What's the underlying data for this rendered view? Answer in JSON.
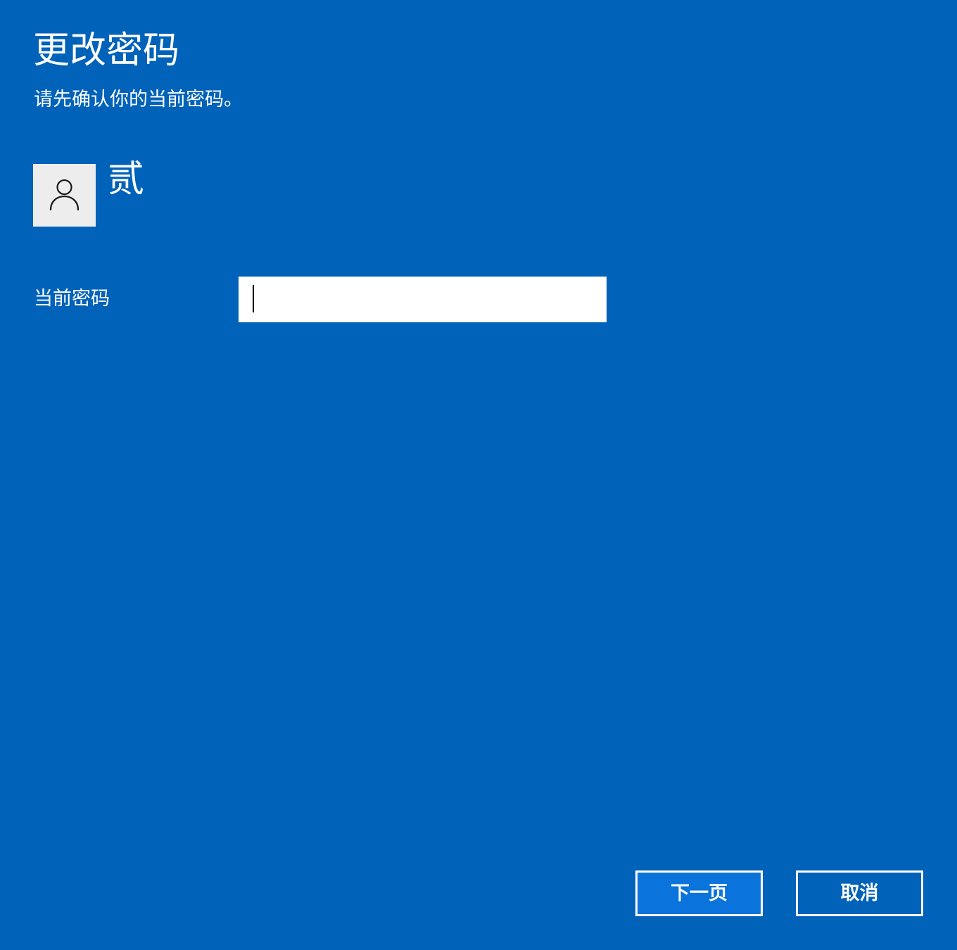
{
  "dialog": {
    "title": "更改密码",
    "subtitle": "请先确认你的当前密码。"
  },
  "account": {
    "username": "贰",
    "avatar_icon": "user-icon"
  },
  "form": {
    "current_password_label": "当前密码",
    "current_password_value": "",
    "current_password_placeholder": ""
  },
  "buttons": {
    "next_label": "下一页",
    "cancel_label": "取消"
  },
  "colors": {
    "background": "#0062b8",
    "next_button": "#0a73dc",
    "avatar_tile": "#ededed"
  }
}
